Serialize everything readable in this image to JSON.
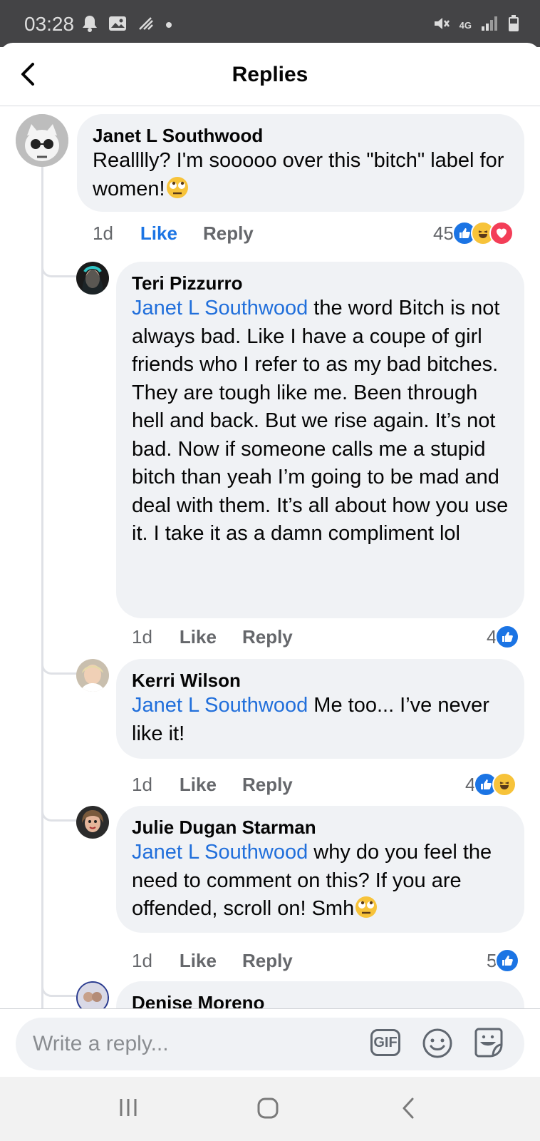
{
  "status_bar": {
    "time": "03:28",
    "network": "4G"
  },
  "header": {
    "title": "Replies"
  },
  "comments": [
    {
      "author": "Janet L Southwood",
      "mention": "",
      "text": "Realllly? I'm sooooo over this \"bitch\" label for women!",
      "trailing_emoji": "rolling-eyes",
      "time": "1d",
      "like_label": "Like",
      "reply_label": "Reply",
      "reaction_count": "45",
      "reactions": [
        "like",
        "haha",
        "love"
      ],
      "liked": true
    },
    {
      "author": "Teri Pizzurro",
      "mention": "Janet L Southwood",
      "text": " the word Bitch is not always bad. Like I have a coupe of girl friends who I refer to as my bad bitches. They are tough like me. Been through hell and back. But we rise again.  It’s not bad. Now if someone calls me a stupid bitch than yeah I’m going to be mad and deal with them. It’s all about how you use it. I take it as a damn compliment lol",
      "time": "1d",
      "like_label": "Like",
      "reply_label": "Reply",
      "reaction_count": "4",
      "reactions": [
        "like"
      ]
    },
    {
      "author": "Kerri Wilson",
      "mention": "Janet L Southwood",
      "text": " Me too... I’ve never like it!",
      "time": "1d",
      "like_label": "Like",
      "reply_label": "Reply",
      "reaction_count": "4",
      "reactions": [
        "like",
        "haha"
      ]
    },
    {
      "author": "Julie Dugan Starman",
      "mention": "Janet L Southwood",
      "text": " why do you feel the need to comment on this? If you are offended, scroll on! Smh",
      "trailing_emoji": "rolling-eyes",
      "time": "1d",
      "like_label": "Like",
      "reply_label": "Reply",
      "reaction_count": "5",
      "reactions": [
        "like"
      ]
    },
    {
      "author": "Denise Moreno",
      "partially_visible": true
    }
  ],
  "composer": {
    "placeholder": "Write a reply...",
    "gif_label": "GIF"
  },
  "colors": {
    "link_blue": "#216fdb",
    "like_blue": "#1b74e4",
    "bubble_gray": "#f0f2f5",
    "secondary_text": "#65676b"
  }
}
